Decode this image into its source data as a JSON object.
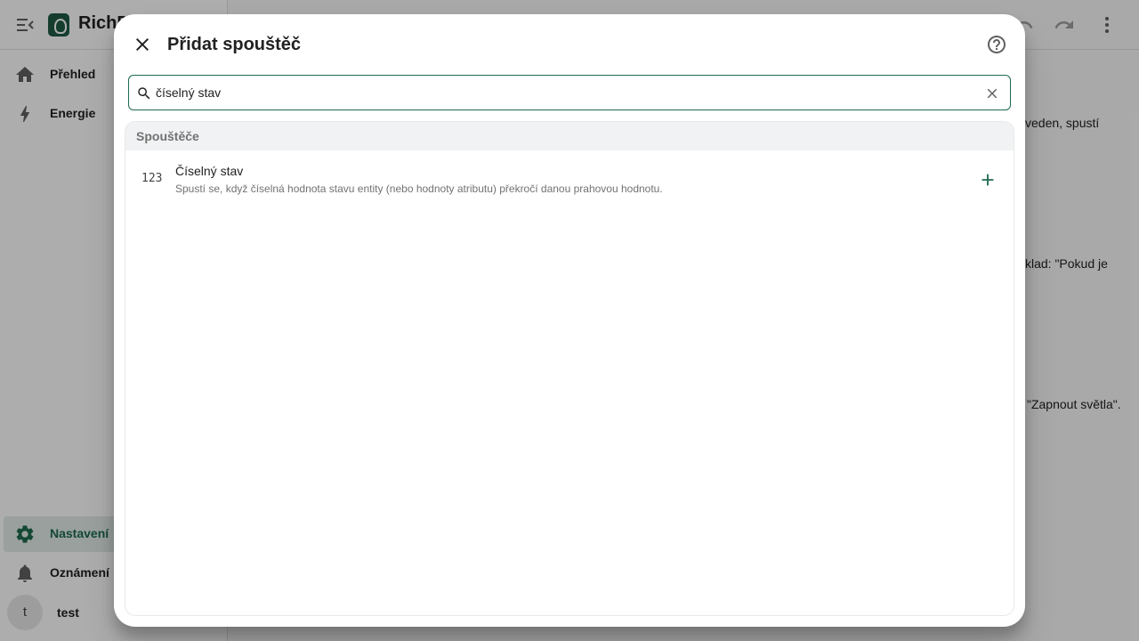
{
  "app": {
    "title": "RichD",
    "menu_icon": "menu-open-icon",
    "logo_icon": "brand-logo-icon"
  },
  "sidebar": {
    "top_items": [
      {
        "label": "Přehled",
        "icon": "home-icon"
      },
      {
        "label": "Energie",
        "icon": "lightning-bolt-icon"
      }
    ],
    "bottom_items": [
      {
        "label": "Nastavení",
        "icon": "cog-icon",
        "active": true
      },
      {
        "label": "Oznámení",
        "icon": "bell-icon"
      }
    ],
    "user": {
      "initial": "t",
      "name": "test"
    }
  },
  "topbar": {
    "icons": [
      "undo-icon",
      "redo-icon",
      "more-vertical-icon"
    ]
  },
  "background_text": {
    "line1": "veden, spustí",
    "line2": "klad: \"Pokud je",
    "line3": "\"Zapnout světla\"."
  },
  "dialog": {
    "title": "Přidat spouštěč",
    "close_icon": "close-icon",
    "help_icon": "help-circle-icon",
    "search": {
      "value": "číselný stav",
      "placeholder": "",
      "search_icon": "search-icon",
      "clear_icon": "clear-icon"
    },
    "results": {
      "section_title": "Spouštěče",
      "items": [
        {
          "icon_text": "123",
          "title": "Číselný stav",
          "description": "Spustí se, když číselná hodnota stavu entity (nebo hodnoty atributu) překročí danou prahovou hodnotu.",
          "action_icon": "plus-icon"
        }
      ]
    }
  },
  "colors": {
    "accent": "#1e6b4f",
    "active_bg": "#e2ece8",
    "scrim": "rgba(0,0,0,0.32)"
  }
}
